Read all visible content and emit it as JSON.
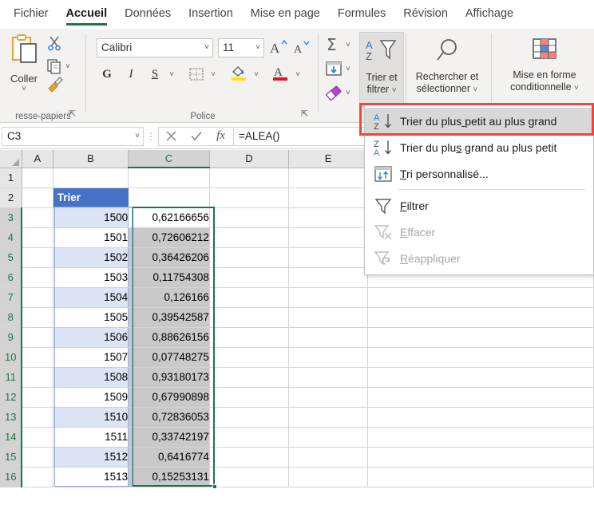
{
  "tabs": [
    {
      "label": "Fichier",
      "active": false
    },
    {
      "label": "Accueil",
      "active": true
    },
    {
      "label": "Données",
      "active": false
    },
    {
      "label": "Insertion",
      "active": false
    },
    {
      "label": "Mise en page",
      "active": false
    },
    {
      "label": "Formules",
      "active": false
    },
    {
      "label": "Révision",
      "active": false
    },
    {
      "label": "Affichage",
      "active": false
    }
  ],
  "ribbon": {
    "clipboard": {
      "group_label": "resse-papiers",
      "paste_label": "Coller",
      "cut_icon": "scissors-icon",
      "copy_icon": "copy-icon",
      "format_painter_icon": "format-painter-icon"
    },
    "font": {
      "group_label": "Police",
      "font_name": "Calibri",
      "font_size": "11",
      "bold_label": "G",
      "italic_label": "I",
      "underline_label": "S",
      "grow_font_icon": "increase-font-size-icon",
      "shrink_font_icon": "decrease-font-size-icon",
      "borders_icon": "borders-icon",
      "fill_color_icon": "fill-color-icon",
      "font_color_icon": "font-color-icon"
    },
    "editing": {
      "autosum_icon": "autosum-icon",
      "fill_icon": "fill-down-icon",
      "clear_icon": "clear-eraser-icon"
    },
    "sort_filter": {
      "label_line1": "Trier et",
      "label_line2": "filtrer",
      "icon": "sort-filter-icon"
    },
    "find_select": {
      "label_line1": "Rechercher et",
      "label_line2": "sélectionner",
      "icon": "magnifier-icon"
    },
    "conditional_formatting": {
      "label_line1": "Mise en forme",
      "label_line2": "conditionnelle",
      "icon": "conditional-formatting-icon"
    }
  },
  "formula_bar": {
    "name_box": "C3",
    "cancel_icon": "cancel-x-icon",
    "confirm_icon": "confirm-check-icon",
    "function_icon": "insert-function-icon",
    "formula": "=ALEA()"
  },
  "menu": {
    "items": [
      {
        "label": "Trier du plus petit au plus grand",
        "accel_index": 13,
        "icon": "sort-az-icon",
        "state": "highlighted"
      },
      {
        "label": "Trier du plus grand au plus petit",
        "accel_index": 12,
        "icon": "sort-za-icon",
        "state": "normal"
      },
      {
        "label": "Tri personnalisé...",
        "accel_index": 0,
        "icon": "custom-sort-icon",
        "state": "normal"
      },
      {
        "label": "Filtrer",
        "accel_index": 0,
        "icon": "filter-icon",
        "state": "normal"
      },
      {
        "label": "Effacer",
        "accel_index": 0,
        "icon": "clear-filter-icon",
        "state": "disabled"
      },
      {
        "label": "Réappliquer",
        "accel_index": 0,
        "icon": "reapply-filter-icon",
        "state": "disabled"
      }
    ],
    "separator_after_index": 2
  },
  "sheet": {
    "columns": [
      "A",
      "B",
      "C",
      "D",
      "E"
    ],
    "rows": [
      "1",
      "2",
      "3",
      "4",
      "5",
      "6",
      "7",
      "8",
      "9",
      "10",
      "11",
      "12",
      "13",
      "14",
      "15",
      "16"
    ],
    "header_cell": "Trier",
    "data": [
      {
        "row": "3",
        "b": "1500",
        "c": "0,62166656"
      },
      {
        "row": "4",
        "b": "1501",
        "c": "0,72606212"
      },
      {
        "row": "5",
        "b": "1502",
        "c": "0,36426206"
      },
      {
        "row": "6",
        "b": "1503",
        "c": "0,11754308"
      },
      {
        "row": "7",
        "b": "1504",
        "c": "0,126166"
      },
      {
        "row": "8",
        "b": "1505",
        "c": "0,39542587"
      },
      {
        "row": "9",
        "b": "1506",
        "c": "0,88626156"
      },
      {
        "row": "10",
        "b": "1507",
        "c": "0,07748275"
      },
      {
        "row": "11",
        "b": "1508",
        "c": "0,93180173"
      },
      {
        "row": "12",
        "b": "1509",
        "c": "0,67990898"
      },
      {
        "row": "13",
        "b": "1510",
        "c": "0,72836053"
      },
      {
        "row": "14",
        "b": "1511",
        "c": "0,33742197"
      },
      {
        "row": "15",
        "b": "1512",
        "c": "0,6416774"
      },
      {
        "row": "16",
        "b": "1513",
        "c": "0,15253131"
      }
    ]
  },
  "colors": {
    "excel_green": "#217346",
    "header_blue": "#4472c4",
    "band_blue": "#dce4f5",
    "selection_grey": "#c9c9c9",
    "annotation_red": "#f4433c"
  }
}
